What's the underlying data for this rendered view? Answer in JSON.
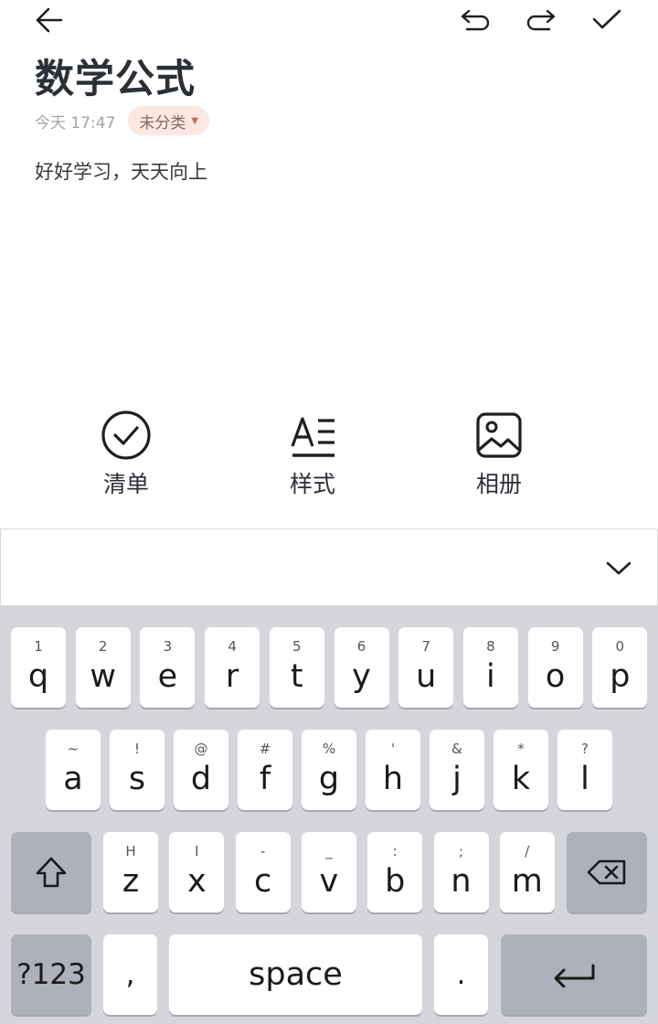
{
  "toolbar_top": {
    "back_icon": "arrow-left-icon",
    "undo_icon": "undo-icon",
    "redo_icon": "redo-icon",
    "done_icon": "check-icon"
  },
  "note": {
    "title": "数学公式",
    "time": "今天 17:47",
    "category": "未分类",
    "body": "好好学习，天天向上"
  },
  "tools": [
    {
      "label": "清单",
      "icon": "checklist-icon"
    },
    {
      "label": "样式",
      "icon": "text-style-icon"
    },
    {
      "label": "相册",
      "icon": "image-icon"
    }
  ],
  "keyboard": {
    "collapse_icon": "chevron-down-icon",
    "row1": [
      {
        "sub": "1",
        "main": "q"
      },
      {
        "sub": "2",
        "main": "w"
      },
      {
        "sub": "3",
        "main": "e"
      },
      {
        "sub": "4",
        "main": "r"
      },
      {
        "sub": "5",
        "main": "t"
      },
      {
        "sub": "6",
        "main": "y"
      },
      {
        "sub": "7",
        "main": "u"
      },
      {
        "sub": "8",
        "main": "i"
      },
      {
        "sub": "9",
        "main": "o"
      },
      {
        "sub": "0",
        "main": "p"
      }
    ],
    "row2": [
      {
        "sub": "~",
        "main": "a"
      },
      {
        "sub": "!",
        "main": "s"
      },
      {
        "sub": "@",
        "main": "d"
      },
      {
        "sub": "#",
        "main": "f"
      },
      {
        "sub": "%",
        "main": "g"
      },
      {
        "sub": "'",
        "main": "h"
      },
      {
        "sub": "&",
        "main": "j"
      },
      {
        "sub": "*",
        "main": "k"
      },
      {
        "sub": "?",
        "main": "l"
      }
    ],
    "row3": [
      {
        "sub": "H",
        "main": "z"
      },
      {
        "sub": "I",
        "main": "x"
      },
      {
        "sub": "-",
        "main": "c"
      },
      {
        "sub": "_",
        "main": "v"
      },
      {
        "sub": ":",
        "main": "b"
      },
      {
        "sub": ";",
        "main": "n"
      },
      {
        "sub": "/",
        "main": "m"
      }
    ],
    "shift_icon": "shift-icon",
    "backspace_icon": "backspace-icon",
    "numbers_label": "?123",
    "comma_label": ",",
    "space_label": "space",
    "period_label": ".",
    "enter_icon": "enter-icon"
  }
}
